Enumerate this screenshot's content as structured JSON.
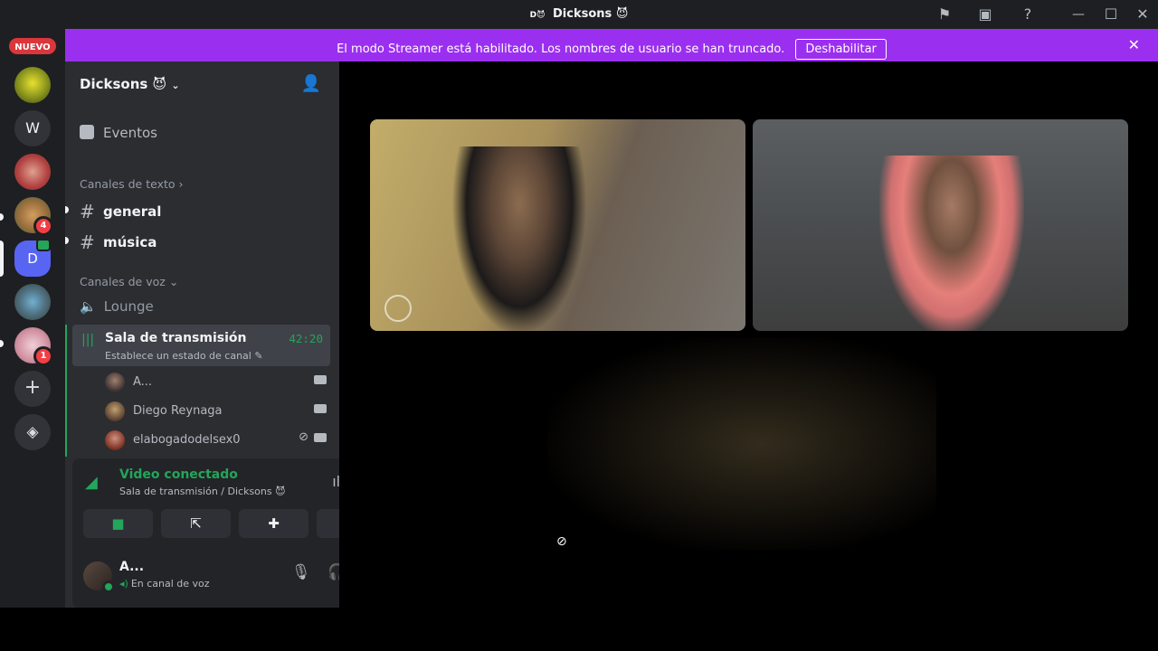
{
  "window": {
    "title": "Dicksons",
    "title_emoji": "😈",
    "title_icon": "D😈"
  },
  "titlebar_icons": [
    "flag-icon",
    "inbox-icon",
    "help-icon",
    "minimize-icon",
    "maximize-icon",
    "close-icon"
  ],
  "rail": {
    "nuevo_label": "NUEVO",
    "letter_server": "W",
    "badge_1": "4",
    "badge_2": "1",
    "server_d_letter": "D"
  },
  "banner": {
    "message": "El modo Streamer está habilitado. Los nombres de usuario se han truncado.",
    "button_label": "Deshabilitar",
    "bg_color": "#9b2ff0"
  },
  "sidebar": {
    "server_name": "Dicksons 😈",
    "events_label": "Eventos",
    "text_category": "Canales de texto",
    "text_channels": [
      {
        "name": "general"
      },
      {
        "name": "música"
      }
    ],
    "voice_category": "Canales de voz",
    "voice_channels": [
      {
        "name": "Lounge"
      }
    ],
    "active_channel": {
      "name": "Sala de transmisión",
      "time": "42:20",
      "status": "Establece un estado de canal"
    },
    "voice_users": [
      {
        "name": "A...",
        "camera": true,
        "muted": false
      },
      {
        "name": "Diego Reynaga",
        "camera": true,
        "muted": false
      },
      {
        "name": "elabogadodelsex0",
        "camera": true,
        "muted": true
      }
    ]
  },
  "voice_panel": {
    "status": "Video conectado",
    "location": "Sala de transmisión / Dicksons 😈",
    "buttons": [
      "camera-icon",
      "screen-share-icon",
      "activities-icon",
      "soundboard-icon"
    ]
  },
  "user_panel": {
    "name": "A...",
    "status": "En canal de voz"
  },
  "accent": {
    "green": "#23a55a",
    "red": "#da373c"
  }
}
